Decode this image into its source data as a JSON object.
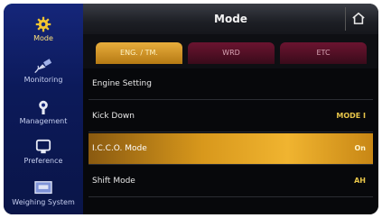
{
  "header": {
    "title": "Mode"
  },
  "sidebar": {
    "items": [
      {
        "label": "Mode",
        "icon": "gear-icon",
        "active": true
      },
      {
        "label": "Monitoring",
        "icon": "satellite-icon",
        "active": false
      },
      {
        "label": "Management",
        "icon": "wrench-icon",
        "active": false
      },
      {
        "label": "Preference",
        "icon": "monitor-icon",
        "active": false
      },
      {
        "label": "Weighing System",
        "icon": "scale-icon",
        "active": false
      }
    ]
  },
  "tabs": [
    {
      "label": "ENG. / TM.",
      "active": true
    },
    {
      "label": "WRD",
      "active": false
    },
    {
      "label": "ETC",
      "active": false
    }
  ],
  "rows": [
    {
      "name": "Engine Setting",
      "value": ""
    },
    {
      "name": "Kick Down",
      "value": "MODE I"
    },
    {
      "name": "I.C.C.O. Mode",
      "value": "On",
      "active": true
    },
    {
      "name": "Shift Mode",
      "value": "AH"
    }
  ],
  "colors": {
    "sidebar_bg": "#0c1a5a",
    "accent_yellow": "#f0b430",
    "tab_inactive": "#5a1228"
  }
}
